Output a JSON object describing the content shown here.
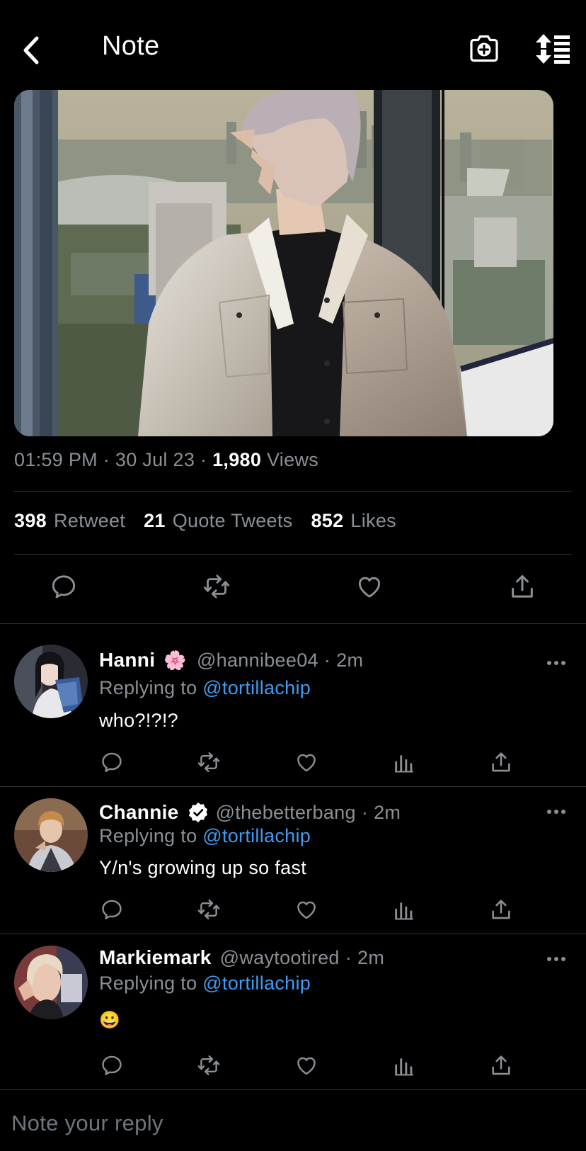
{
  "header": {
    "title": "Note"
  },
  "tweet": {
    "time": "01:59 PM",
    "date": "30 Jul 23",
    "views_count": "1,980",
    "views_label": "Views",
    "retweets_count": "398",
    "retweets_label": "Retweet",
    "quotes_count": "21",
    "quotes_label": "Quote Tweets",
    "likes_count": "852",
    "likes_label": "Likes"
  },
  "replies": [
    {
      "name": "Hanni",
      "emoji": "🌸",
      "handle": "@hannibee04",
      "time": "2m",
      "replying_label": "Replying to",
      "replying_to": "@tortillachip",
      "text": "who?!?!?"
    },
    {
      "name": "Channie",
      "verified": true,
      "handle": "@thebetterbang",
      "time": "2m",
      "replying_label": "Replying to",
      "replying_to": "@tortillachip",
      "text": "Y/n's growing up so fast"
    },
    {
      "name": "Markiemark",
      "handle": "@waytootired",
      "time": "2m",
      "replying_label": "Replying to",
      "replying_to": "@tortillachip",
      "text": "😀"
    }
  ],
  "compose": {
    "placeholder": "Note your reply"
  },
  "icons": {
    "header": [
      "back-arrow-icon",
      "camera-plus-icon",
      "sort-icon"
    ],
    "actions": [
      "reply-icon",
      "retweet-icon",
      "like-icon",
      "views-icon",
      "share-icon"
    ]
  },
  "colors": {
    "background": "#000000",
    "mention": "#3e9bf2",
    "secondary_text": "#8b9096",
    "divider": "#2f3336"
  }
}
